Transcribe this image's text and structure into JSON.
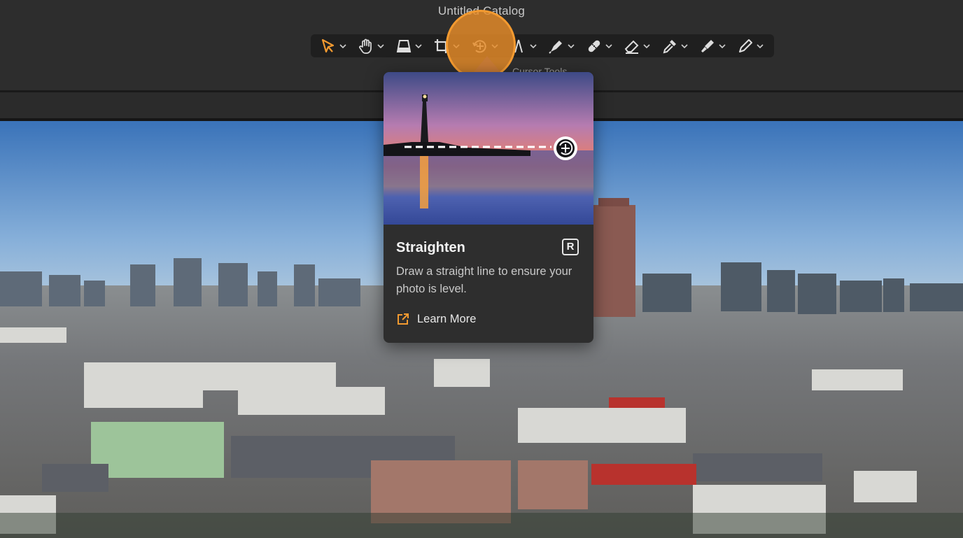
{
  "window": {
    "title": "Untitled Catalog"
  },
  "toolbar": {
    "label": "Cursor Tools",
    "tools": [
      {
        "icon": "arrow-cursor-icon",
        "active": true
      },
      {
        "icon": "hand-icon"
      },
      {
        "icon": "perspective-icon"
      },
      {
        "icon": "crop-icon"
      },
      {
        "icon": "straighten-icon",
        "highlighted": true
      },
      {
        "icon": "line-tool-icon"
      },
      {
        "icon": "pen-icon"
      },
      {
        "icon": "bandage-icon"
      },
      {
        "icon": "eraser-icon"
      },
      {
        "icon": "eyedropper-icon"
      },
      {
        "icon": "brush-icon"
      },
      {
        "icon": "pencil-icon"
      }
    ]
  },
  "popover": {
    "title": "Straighten",
    "shortcut": "R",
    "description": "Draw a straight line to ensure your photo is level.",
    "link_label": "Learn More"
  },
  "colors": {
    "accent": "#f39a30",
    "toolbar_bg": "#1f1f1f",
    "app_bg": "#2d2d2d"
  }
}
